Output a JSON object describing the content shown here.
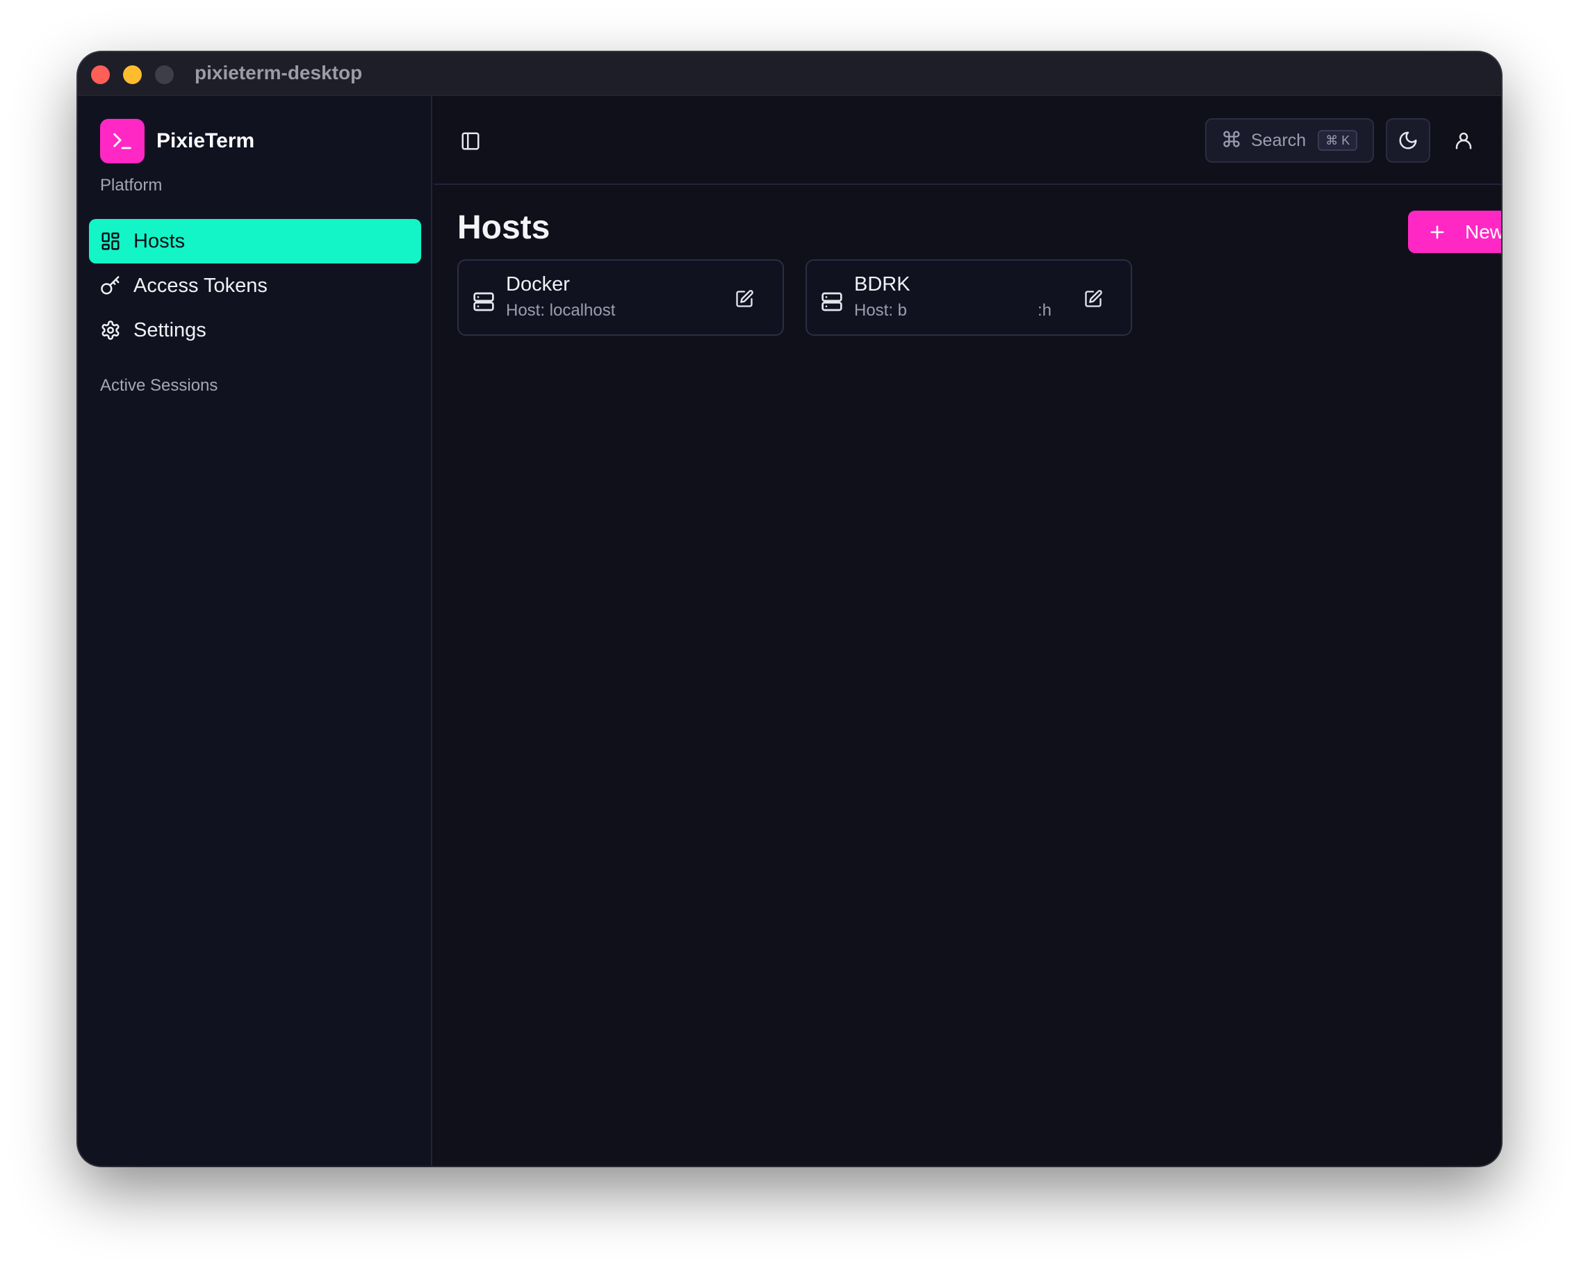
{
  "window": {
    "title": "pixieterm-desktop"
  },
  "brand": {
    "name": "PixieTerm",
    "logo_icon": "terminal-prompt-icon",
    "accent": "#ff28c4"
  },
  "sidebar": {
    "platform_label": "Platform",
    "items": [
      {
        "label": "Hosts",
        "icon": "grid-icon",
        "active": true
      },
      {
        "label": "Access Tokens",
        "icon": "key-icon",
        "active": false
      },
      {
        "label": "Settings",
        "icon": "gear-icon",
        "active": false
      }
    ],
    "sessions_label": "Active Sessions",
    "active_color": "#13f5c6"
  },
  "topbar": {
    "search_label": "Search",
    "search_shortcut": "⌘ K",
    "theme_icon": "moon-icon",
    "user_icon": "user-icon"
  },
  "main": {
    "title": "Hosts",
    "new_host_label": "New Host",
    "hosts": [
      {
        "name": "Docker",
        "sub": "Host: localhost",
        "sub_tail": ""
      },
      {
        "name": "BDRK",
        "sub": "Host: b",
        "sub_tail": ":h"
      }
    ]
  }
}
